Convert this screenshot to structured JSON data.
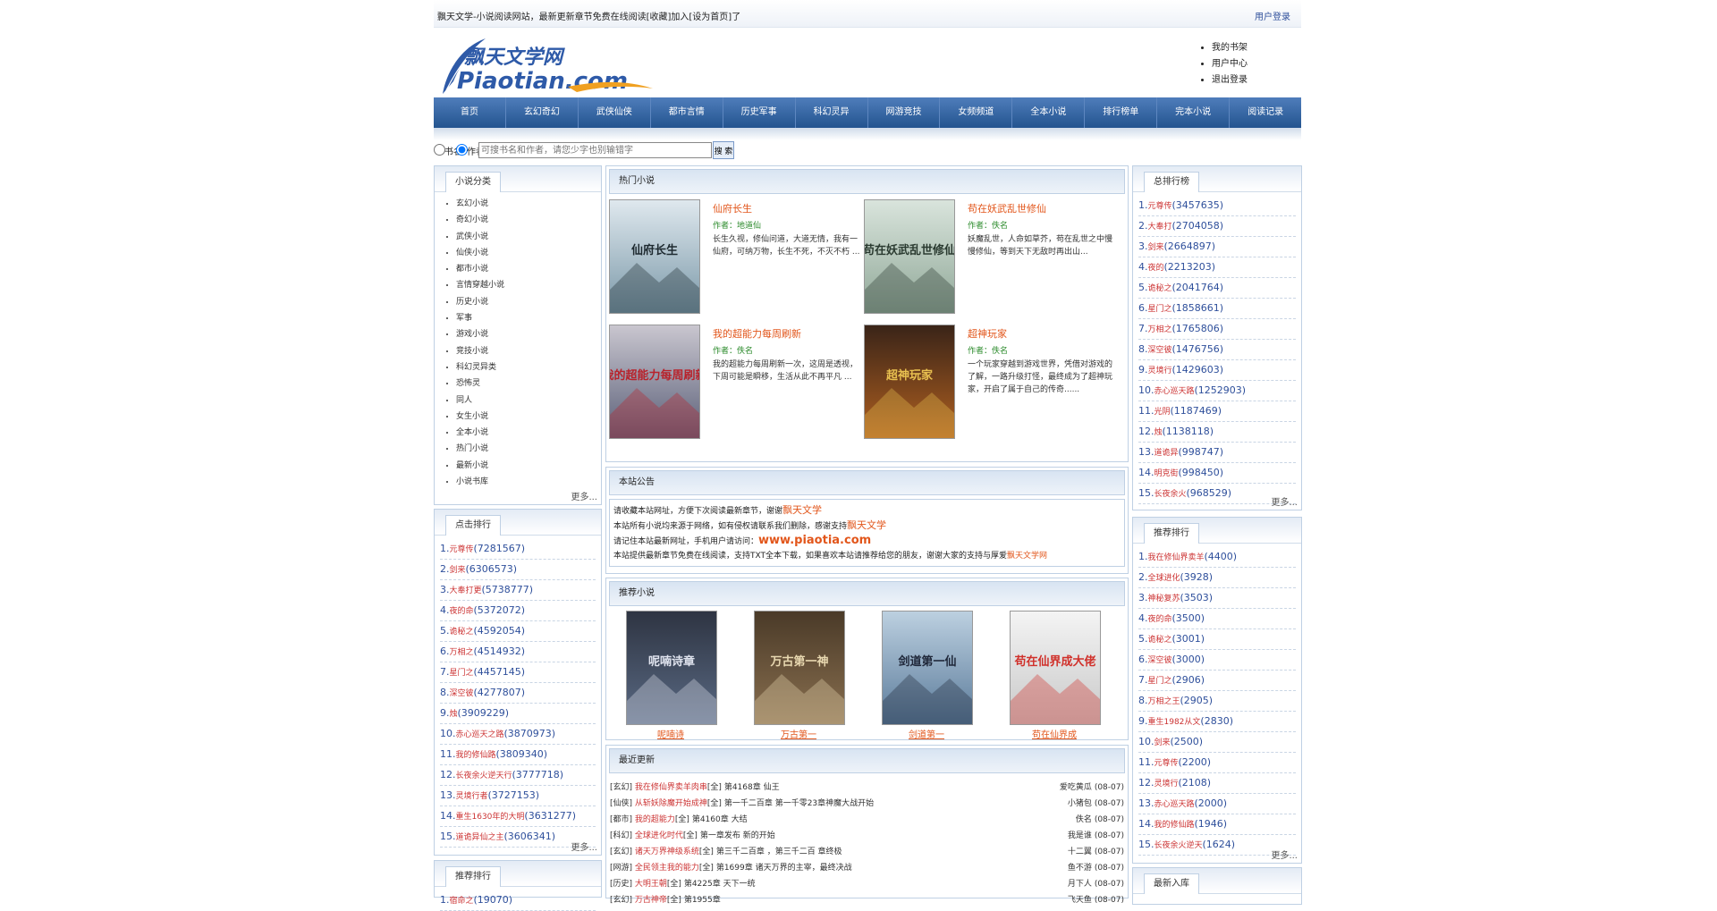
{
  "topbar": {
    "left": "飘天文学-小说阅读网站，最新更新章节免费在线阅读[收藏]加入[设为首页]了",
    "right": "用户登录"
  },
  "header": {
    "links": [
      "我的书架",
      "用户中心",
      "退出登录"
    ]
  },
  "nav": [
    "首页",
    "玄幻奇幻",
    "武侠仙侠",
    "都市言情",
    "历史军事",
    "科幻灵异",
    "网游竞技",
    "女频频道",
    "全本小说",
    "排行榜单",
    "完本小说",
    "阅读记录"
  ],
  "search": {
    "opt1": "书名",
    "opt2": "作者",
    "placeholder": "可搜书名和作者，请您少字也别输错字",
    "button": "搜 索"
  },
  "left": {
    "cats_title": "小说分类",
    "cats": [
      "玄幻小说",
      "奇幻小说",
      "武侠小说",
      "仙侠小说",
      "都市小说",
      "言情穿越小说",
      "历史小说",
      "军事",
      "游戏小说",
      "竞技小说",
      "科幻灵异类",
      "恐怖灵",
      "同人",
      "女生小说",
      "全本小说",
      "热门小说",
      "最新小说",
      "小说书库"
    ],
    "cats_more": "更多...",
    "rank_title": "点击排行",
    "rank": [
      {
        "n": "1.",
        "name": "元尊传",
        "count": "(7281567)"
      },
      {
        "n": "2.",
        "name": "剑来",
        "count": "(6306573)"
      },
      {
        "n": "3.",
        "name": "大奉打更",
        "count": "(5738777)"
      },
      {
        "n": "4.",
        "name": "夜的命",
        "count": "(5372072)"
      },
      {
        "n": "5.",
        "name": "诡秘之",
        "count": "(4592054)"
      },
      {
        "n": "6.",
        "name": "万相之",
        "count": "(4514932)"
      },
      {
        "n": "7.",
        "name": "星门之",
        "count": "(4457145)"
      },
      {
        "n": "8.",
        "name": "深空彼",
        "count": "(4277807)"
      },
      {
        "n": "9.",
        "name": "烛",
        "count": "(3909229)"
      },
      {
        "n": "10.",
        "name": "赤心巡天之路",
        "count": "(3870973)"
      },
      {
        "n": "11.",
        "name": "我的修仙路",
        "count": "(3809340)"
      },
      {
        "n": "12.",
        "name": "长夜余火逆天行",
        "count": "(3777718)"
      },
      {
        "n": "13.",
        "name": "灵境行者",
        "count": "(3727153)"
      },
      {
        "n": "14.",
        "name": "重生1630年的大明",
        "count": "(3631277)"
      },
      {
        "n": "15.",
        "name": "道诡异仙之主",
        "count": "(3606341)"
      }
    ],
    "rank_more": "更多...",
    "rank2_title": "推荐排行",
    "rank2": [
      {
        "n": "1.",
        "name": "宿命之",
        "count": "(19070)"
      }
    ]
  },
  "center": {
    "hot_title": "热门小说",
    "hot": [
      {
        "title": "仙府长生",
        "author": "作者：地道仙",
        "desc": "长生久视，修仙问道，大道无情，我有一仙府，可纳万物，长生不死，不灭不朽 ...",
        "cover_text": "仙府长生"
      },
      {
        "title": "苟在妖武乱世修仙",
        "author": "作者：佚名",
        "desc": "妖魔乱世，人命如草芥，苟在乱世之中慢慢修仙，等到天下无敌时再出山...",
        "cover_text": "苟在妖武乱世修仙"
      },
      {
        "title": "我的超能力每周刷新",
        "author": "作者：佚名",
        "desc": "我的超能力每周刷新一次，这周是透视，下周可能是瞬移，生活从此不再平凡 ...",
        "cover_text": "我的超能力每周刷新"
      },
      {
        "title": "超神玩家",
        "author": "作者：佚名",
        "desc": "一个玩家穿越到游戏世界，凭借对游戏的了解，一路升级打怪，最终成为了超神玩家，开启了属于自己的传奇......",
        "cover_text": "超神玩家"
      }
    ],
    "notice_title": "本站公告",
    "notice": [
      {
        "text": "请收藏本站网址，方便下次阅读最新章节，谢谢",
        "hl": "飘天文学"
      },
      {
        "text": "本站所有小说均来源于网络，如有侵权请联系我们删除，感谢支持",
        "hl": "飘天文学"
      },
      {
        "text": "请记住本站最新网址，手机用户请访问：",
        "hl": "www.piaotia.com"
      },
      {
        "text": "本站提供最新章节免费在线阅读，支持TXT全本下载，如果喜欢本站请推荐给您的朋友，谢谢大家的支持与厚爱",
        "hl": "飘天文学网"
      }
    ],
    "rec_title": "推荐小说",
    "rec": [
      {
        "name": "呢喃诗",
        "cover_text": "呢喃诗章"
      },
      {
        "name": "万古第一",
        "cover_text": "万古第一神"
      },
      {
        "name": "剑道第一",
        "cover_text": "剑道第一仙"
      },
      {
        "name": "苟在仙界成",
        "cover_text": "苟在仙界成大佬"
      }
    ],
    "upd_title": "最近更新",
    "updates": [
      {
        "cat": "[玄幻]",
        "book": "我在修仙界卖羊肉串",
        "tag": "[全]",
        "chap": "第4168章 仙王",
        "author": "爱吃黄瓜",
        "date": "(08-07)"
      },
      {
        "cat": "[仙侠]",
        "book": "从斩妖除魔开始成神",
        "tag": "[全]",
        "chap": "第一千二百章 第一千零23章神魔大战开始",
        "author": "小猪包",
        "date": "(08-07)"
      },
      {
        "cat": "[都市]",
        "book": "我的超能力",
        "tag": "[全]",
        "chap": "第4160章 大结",
        "author": "佚名",
        "date": "(08-07)"
      },
      {
        "cat": "[科幻]",
        "book": "全球进化时代",
        "tag": "[全]",
        "chap": "第一章发布 新的开始",
        "author": "我是谁",
        "date": "(08-07)"
      },
      {
        "cat": "[玄幻]",
        "book": "诸天万界神级系统",
        "tag": "[全]",
        "chap": "第三千二百章 ，第三千二百 章终极",
        "author": "十二翼",
        "date": "(08-07)"
      },
      {
        "cat": "[网游]",
        "book": "全民领主我的能力",
        "tag": "[全]",
        "chap": "第1699章 诸天万界的主宰，最终决战",
        "author": "鱼不游",
        "date": "(08-07)"
      },
      {
        "cat": "[历史]",
        "book": "大明王朝",
        "tag": "[全]",
        "chap": "第4225章 天下一统",
        "author": "月下人",
        "date": "(08-07)"
      },
      {
        "cat": "[玄幻]",
        "book": "万古神帝",
        "tag": "[全]",
        "chap": "第1955章",
        "author": "飞天鱼",
        "date": "(08-07)"
      }
    ]
  },
  "right": {
    "rank_title": "总排行榜",
    "rank": [
      {
        "n": "1.",
        "name": "元尊传",
        "count": "(3457635)"
      },
      {
        "n": "2.",
        "name": "大奉打",
        "count": "(2704058)"
      },
      {
        "n": "3.",
        "name": "剑来",
        "count": "(2664897)"
      },
      {
        "n": "4.",
        "name": "夜的",
        "count": "(2213203)"
      },
      {
        "n": "5.",
        "name": "诡秘之",
        "count": "(2041764)"
      },
      {
        "n": "6.",
        "name": "星门之",
        "count": "(1858661)"
      },
      {
        "n": "7.",
        "name": "万相之",
        "count": "(1765806)"
      },
      {
        "n": "8.",
        "name": "深空彼",
        "count": "(1476756)"
      },
      {
        "n": "9.",
        "name": "灵境行",
        "count": "(1429603)"
      },
      {
        "n": "10.",
        "name": "赤心巡天路",
        "count": "(1252903)"
      },
      {
        "n": "11.",
        "name": "光阴",
        "count": "(1187469)"
      },
      {
        "n": "12.",
        "name": "烛",
        "count": "(1138118)"
      },
      {
        "n": "13.",
        "name": "道诡异",
        "count": "(998747)"
      },
      {
        "n": "14.",
        "name": "明克街",
        "count": "(998450)"
      },
      {
        "n": "15.",
        "name": "长夜余火",
        "count": "(968529)"
      }
    ],
    "rank_more": "更多...",
    "rank2_title": "推荐排行",
    "rank2": [
      {
        "n": "1.",
        "name": "我在修仙界卖羊",
        "count": "(4400)"
      },
      {
        "n": "2.",
        "name": "全球进化",
        "count": "(3928)"
      },
      {
        "n": "3.",
        "name": "神秘复苏",
        "count": "(3503)"
      },
      {
        "n": "4.",
        "name": "夜的命",
        "count": "(3500)"
      },
      {
        "n": "5.",
        "name": "诡秘之",
        "count": "(3001)"
      },
      {
        "n": "6.",
        "name": "深空彼",
        "count": "(3000)"
      },
      {
        "n": "7.",
        "name": "星门之",
        "count": "(2906)"
      },
      {
        "n": "8.",
        "name": "万相之王",
        "count": "(2905)"
      },
      {
        "n": "9.",
        "name": "重生1982从文",
        "count": "(2830)"
      },
      {
        "n": "10.",
        "name": "剑来",
        "count": "(2500)"
      },
      {
        "n": "11.",
        "name": "元尊传",
        "count": "(2200)"
      },
      {
        "n": "12.",
        "name": "灵境行",
        "count": "(2108)"
      },
      {
        "n": "13.",
        "name": "赤心巡天路",
        "count": "(2000)"
      },
      {
        "n": "14.",
        "name": "我的修仙路",
        "count": "(1946)"
      },
      {
        "n": "15.",
        "name": "长夜余火逆天",
        "count": "(1624)"
      }
    ],
    "rank2_more": "更多...",
    "rank3_title": "最新入库"
  }
}
